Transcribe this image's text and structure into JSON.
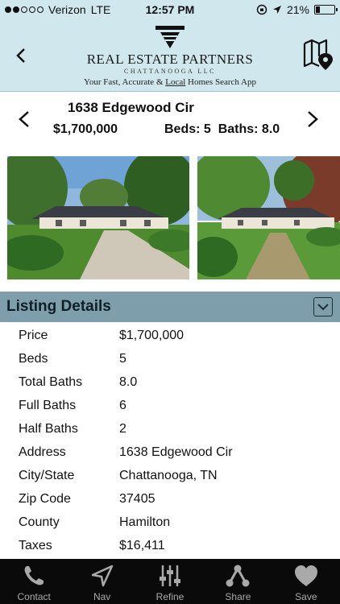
{
  "status_bar": {
    "carrier": "Verizon",
    "network": "LTE",
    "time": "12:57 PM",
    "battery": "21%",
    "battery_level": 0.21,
    "signal_bars": 2
  },
  "header": {
    "brand_name": "REAL ESTATE PARTNERS",
    "brand_sub": "CHATTANOOGA LLC",
    "tagline_pre": "Your Fast, Accurate & ",
    "tagline_underlined": "Local",
    "tagline_post": " Homes Search App",
    "back_icon": "chevron-left-icon",
    "map_icon": "map-pin-icon"
  },
  "property": {
    "address": "1638 Edgewood Cir",
    "price": "$1,700,000",
    "beds_baths": "Beds: 5  Baths: 8.0"
  },
  "details": {
    "title": "Listing Details",
    "rows": [
      {
        "label": "Price",
        "value": "$1,700,000"
      },
      {
        "label": "Beds",
        "value": "5"
      },
      {
        "label": "Total Baths",
        "value": "8.0"
      },
      {
        "label": "Full Baths",
        "value": "6"
      },
      {
        "label": "Half Baths",
        "value": "2"
      },
      {
        "label": "Address",
        "value": "1638 Edgewood Cir"
      },
      {
        "label": "City/State",
        "value": "Chattanooga, TN"
      },
      {
        "label": "Zip Code",
        "value": "37405"
      },
      {
        "label": "County",
        "value": "Hamilton"
      },
      {
        "label": "Taxes",
        "value": "$16,411"
      }
    ]
  },
  "tabs": [
    {
      "label": "Contact",
      "icon": "phone-icon"
    },
    {
      "label": "Nav",
      "icon": "navigation-arrow-icon"
    },
    {
      "label": "Refine",
      "icon": "sliders-icon"
    },
    {
      "label": "Share",
      "icon": "share-icon"
    },
    {
      "label": "Save",
      "icon": "heart-icon"
    }
  ],
  "colors": {
    "header_bg": "#cfe7ed",
    "section_header_bg": "#7f9eac",
    "tab_bar_bg": "#0a0a0a",
    "tab_text": "#a9a9a9"
  }
}
